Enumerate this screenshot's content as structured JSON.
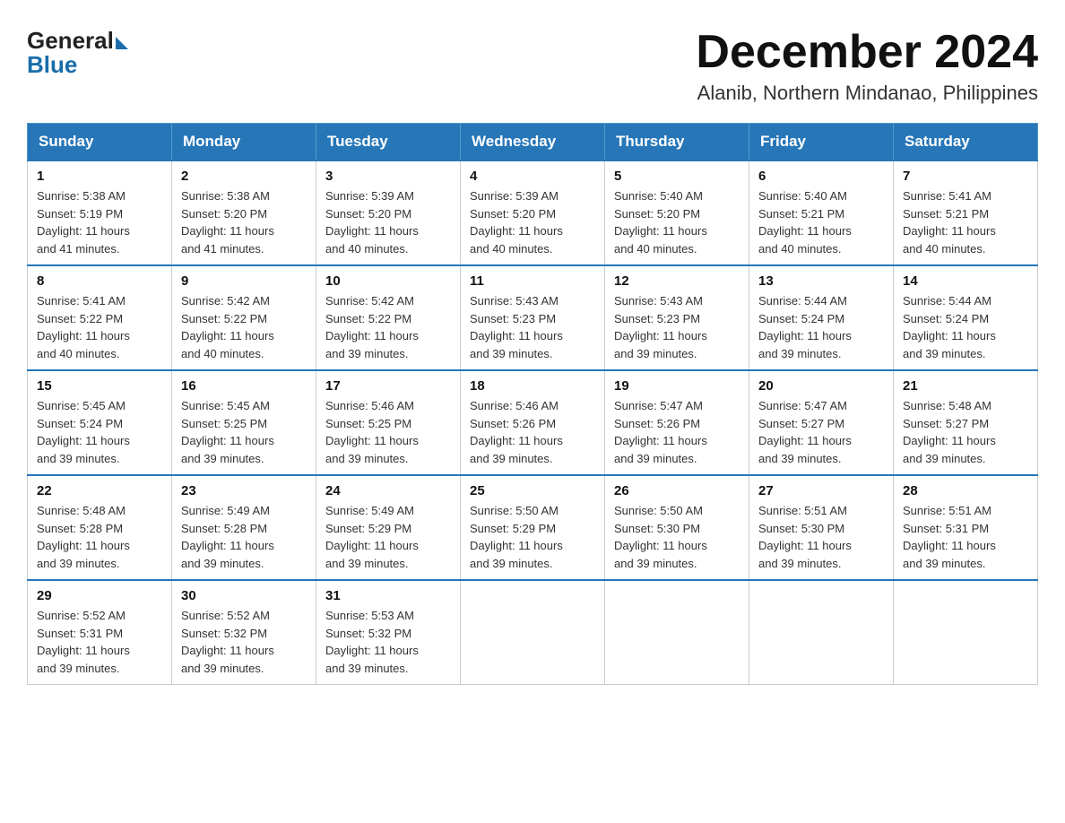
{
  "logo": {
    "general": "General",
    "blue": "Blue"
  },
  "header": {
    "month_year": "December 2024",
    "location": "Alanib, Northern Mindanao, Philippines"
  },
  "days_of_week": [
    "Sunday",
    "Monday",
    "Tuesday",
    "Wednesday",
    "Thursday",
    "Friday",
    "Saturday"
  ],
  "weeks": [
    [
      {
        "day": "1",
        "sunrise": "5:38 AM",
        "sunset": "5:19 PM",
        "daylight": "11 hours and 41 minutes."
      },
      {
        "day": "2",
        "sunrise": "5:38 AM",
        "sunset": "5:20 PM",
        "daylight": "11 hours and 41 minutes."
      },
      {
        "day": "3",
        "sunrise": "5:39 AM",
        "sunset": "5:20 PM",
        "daylight": "11 hours and 40 minutes."
      },
      {
        "day": "4",
        "sunrise": "5:39 AM",
        "sunset": "5:20 PM",
        "daylight": "11 hours and 40 minutes."
      },
      {
        "day": "5",
        "sunrise": "5:40 AM",
        "sunset": "5:20 PM",
        "daylight": "11 hours and 40 minutes."
      },
      {
        "day": "6",
        "sunrise": "5:40 AM",
        "sunset": "5:21 PM",
        "daylight": "11 hours and 40 minutes."
      },
      {
        "day": "7",
        "sunrise": "5:41 AM",
        "sunset": "5:21 PM",
        "daylight": "11 hours and 40 minutes."
      }
    ],
    [
      {
        "day": "8",
        "sunrise": "5:41 AM",
        "sunset": "5:22 PM",
        "daylight": "11 hours and 40 minutes."
      },
      {
        "day": "9",
        "sunrise": "5:42 AM",
        "sunset": "5:22 PM",
        "daylight": "11 hours and 40 minutes."
      },
      {
        "day": "10",
        "sunrise": "5:42 AM",
        "sunset": "5:22 PM",
        "daylight": "11 hours and 39 minutes."
      },
      {
        "day": "11",
        "sunrise": "5:43 AM",
        "sunset": "5:23 PM",
        "daylight": "11 hours and 39 minutes."
      },
      {
        "day": "12",
        "sunrise": "5:43 AM",
        "sunset": "5:23 PM",
        "daylight": "11 hours and 39 minutes."
      },
      {
        "day": "13",
        "sunrise": "5:44 AM",
        "sunset": "5:24 PM",
        "daylight": "11 hours and 39 minutes."
      },
      {
        "day": "14",
        "sunrise": "5:44 AM",
        "sunset": "5:24 PM",
        "daylight": "11 hours and 39 minutes."
      }
    ],
    [
      {
        "day": "15",
        "sunrise": "5:45 AM",
        "sunset": "5:24 PM",
        "daylight": "11 hours and 39 minutes."
      },
      {
        "day": "16",
        "sunrise": "5:45 AM",
        "sunset": "5:25 PM",
        "daylight": "11 hours and 39 minutes."
      },
      {
        "day": "17",
        "sunrise": "5:46 AM",
        "sunset": "5:25 PM",
        "daylight": "11 hours and 39 minutes."
      },
      {
        "day": "18",
        "sunrise": "5:46 AM",
        "sunset": "5:26 PM",
        "daylight": "11 hours and 39 minutes."
      },
      {
        "day": "19",
        "sunrise": "5:47 AM",
        "sunset": "5:26 PM",
        "daylight": "11 hours and 39 minutes."
      },
      {
        "day": "20",
        "sunrise": "5:47 AM",
        "sunset": "5:27 PM",
        "daylight": "11 hours and 39 minutes."
      },
      {
        "day": "21",
        "sunrise": "5:48 AM",
        "sunset": "5:27 PM",
        "daylight": "11 hours and 39 minutes."
      }
    ],
    [
      {
        "day": "22",
        "sunrise": "5:48 AM",
        "sunset": "5:28 PM",
        "daylight": "11 hours and 39 minutes."
      },
      {
        "day": "23",
        "sunrise": "5:49 AM",
        "sunset": "5:28 PM",
        "daylight": "11 hours and 39 minutes."
      },
      {
        "day": "24",
        "sunrise": "5:49 AM",
        "sunset": "5:29 PM",
        "daylight": "11 hours and 39 minutes."
      },
      {
        "day": "25",
        "sunrise": "5:50 AM",
        "sunset": "5:29 PM",
        "daylight": "11 hours and 39 minutes."
      },
      {
        "day": "26",
        "sunrise": "5:50 AM",
        "sunset": "5:30 PM",
        "daylight": "11 hours and 39 minutes."
      },
      {
        "day": "27",
        "sunrise": "5:51 AM",
        "sunset": "5:30 PM",
        "daylight": "11 hours and 39 minutes."
      },
      {
        "day": "28",
        "sunrise": "5:51 AM",
        "sunset": "5:31 PM",
        "daylight": "11 hours and 39 minutes."
      }
    ],
    [
      {
        "day": "29",
        "sunrise": "5:52 AM",
        "sunset": "5:31 PM",
        "daylight": "11 hours and 39 minutes."
      },
      {
        "day": "30",
        "sunrise": "5:52 AM",
        "sunset": "5:32 PM",
        "daylight": "11 hours and 39 minutes."
      },
      {
        "day": "31",
        "sunrise": "5:53 AM",
        "sunset": "5:32 PM",
        "daylight": "11 hours and 39 minutes."
      },
      null,
      null,
      null,
      null
    ]
  ],
  "labels": {
    "sunrise": "Sunrise: ",
    "sunset": "Sunset: ",
    "daylight": "Daylight: "
  }
}
